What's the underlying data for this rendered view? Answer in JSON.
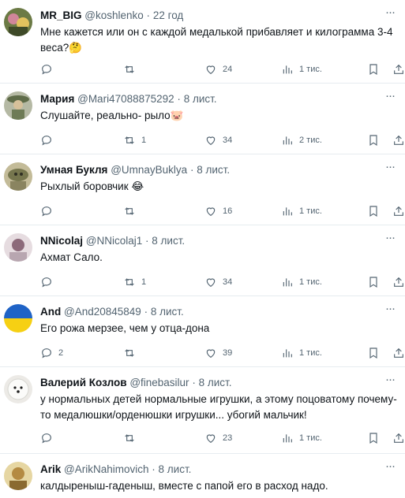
{
  "tweets": [
    {
      "name": "MR_BIG",
      "handle": "@koshlenko",
      "dot": "·",
      "time": "22 год",
      "text": "Мне кажется или он с каждой медалькой прибавляет и килограмма 3-4 веса?🤔",
      "replies": "",
      "retweets": "",
      "likes": "24",
      "views": "1 тис.",
      "avatar_colors": [
        "#5a6b3a",
        "#c87a8a",
        "#e0c060"
      ]
    },
    {
      "name": "Мария",
      "handle": "@Mari47088875292",
      "dot": "·",
      "time": "8 лист.",
      "text": "Слушайте, реально- рыло🐷",
      "replies": "",
      "retweets": "1",
      "likes": "34",
      "views": "2 тис.",
      "avatar_colors": [
        "#9aa08a",
        "#6b7a5a",
        "#d8c8a0"
      ]
    },
    {
      "name": "Умная Букля",
      "handle": "@UmnayBuklya",
      "dot": "·",
      "time": "8 лист.",
      "text": "Рыхлый боровчик 😂",
      "replies": "",
      "retweets": "",
      "likes": "16",
      "views": "1 тис.",
      "avatar_colors": [
        "#7a7a5a",
        "#b8b090",
        "#4a4a3a"
      ]
    },
    {
      "name": "NNicolaj",
      "handle": "@NNicolaj1",
      "dot": "·",
      "time": "8 лист.",
      "text": "Ахмат Сало.",
      "replies": "",
      "retweets": "1",
      "likes": "34",
      "views": "1 тис.",
      "avatar_colors": [
        "#b8a8b0",
        "#806070",
        "#e8dde0"
      ]
    },
    {
      "name": "And",
      "handle": "@And20845849",
      "dot": "·",
      "time": "8 лист.",
      "text": "Его рожа мерзее, чем у отца-дона",
      "replies": "2",
      "retweets": "",
      "likes": "39",
      "views": "1 тис.",
      "avatar_colors": [
        "#1f63c6",
        "#f6d013",
        "#ffffff"
      ]
    },
    {
      "name": "Валерий Козлов",
      "handle": "@finebasilur",
      "dot": "·",
      "time": "8 лист.",
      "text": "у нормальных детей нормальные игрушки, а этому поцоватому почему-то медалюшки/орденюшки игрушки... убогий мальчик!",
      "replies": "",
      "retweets": "",
      "likes": "23",
      "views": "1 тис.",
      "avatar_colors": [
        "#f4f4f2",
        "#d8d8d4",
        "#333333"
      ]
    },
    {
      "name": "Arik",
      "handle": "@ArikNahimovich",
      "dot": "·",
      "time": "8 лист.",
      "text": "калдыреныш-гаденыш, вместе с папой его в расход надо.",
      "replies": "",
      "retweets": "",
      "likes": "",
      "views": "",
      "avatar_colors": [
        "#c8a050",
        "#8a6a30",
        "#e8d8a0"
      ]
    }
  ]
}
